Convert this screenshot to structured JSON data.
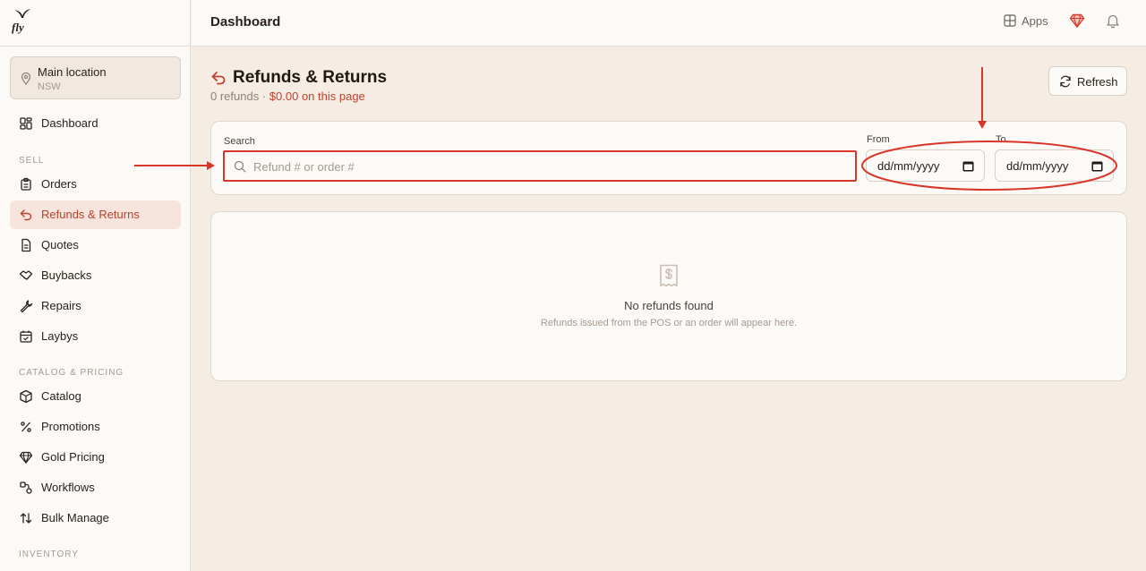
{
  "app": {
    "logo_text": "fly"
  },
  "sidebar": {
    "location": {
      "name": "Main location",
      "region": "NSW"
    },
    "dashboard_label": "Dashboard",
    "sections": {
      "sell": "SELL",
      "catalog": "CATALOG & PRICING",
      "inventory": "INVENTORY"
    },
    "items": {
      "orders": "Orders",
      "refunds": "Refunds & Returns",
      "quotes": "Quotes",
      "buybacks": "Buybacks",
      "repairs": "Repairs",
      "laybys": "Laybys",
      "catalog": "Catalog",
      "promotions": "Promotions",
      "gold_pricing": "Gold Pricing",
      "workflows": "Workflows",
      "bulk_manage": "Bulk Manage"
    }
  },
  "header": {
    "title": "Dashboard",
    "apps_label": "Apps"
  },
  "page": {
    "title": "Refunds & Returns",
    "count_text": "0 refunds",
    "separator": "·",
    "amount_text": "$0.00 on this page",
    "refresh_label": "Refresh"
  },
  "filters": {
    "search_label": "Search",
    "search_placeholder": "Refund # or order #",
    "from_label": "From",
    "to_label": "To",
    "from_value": "dd/mm/yyyy",
    "to_value": "dd/mm/yyyy"
  },
  "empty": {
    "title": "No refunds found",
    "subtitle": "Refunds issued from the POS or an order will appear here."
  },
  "colors": {
    "accent": "#c2412d",
    "annotation": "#d9362a",
    "sidebar_bg": "#fcfaf6",
    "page_bg": "#f5ece4"
  }
}
